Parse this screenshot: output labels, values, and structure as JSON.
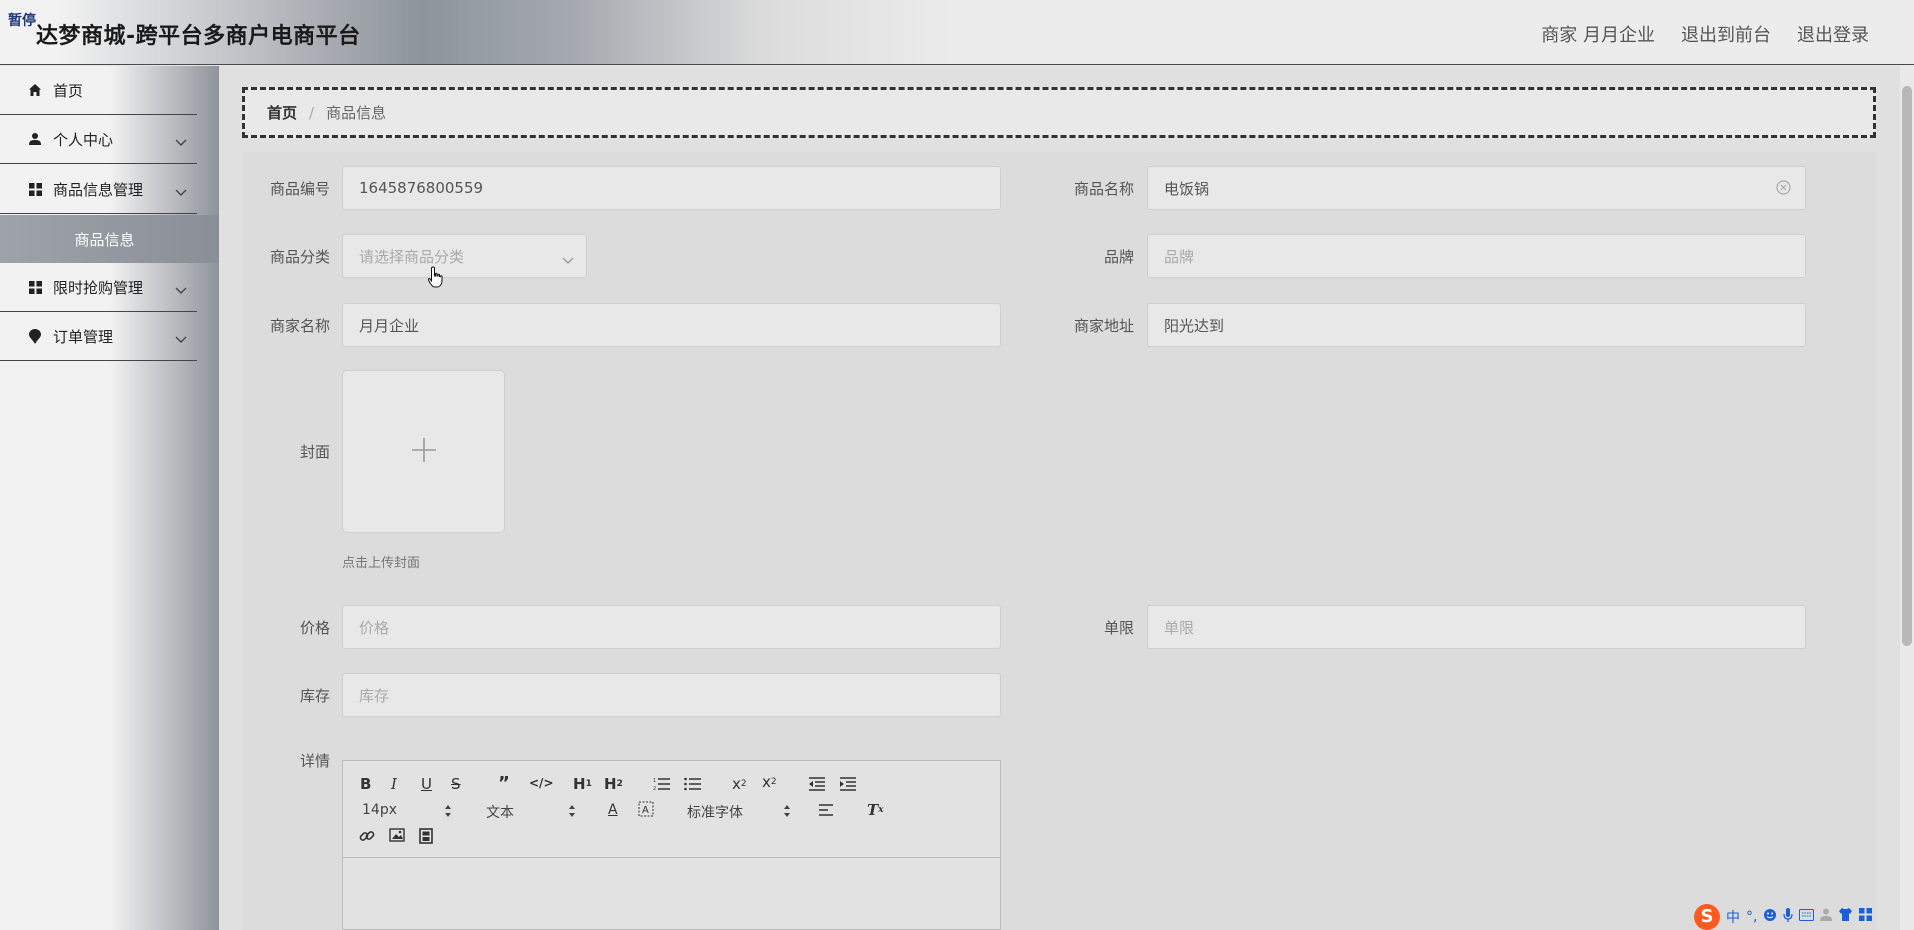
{
  "header": {
    "logo_tag": "暂停",
    "title": "达梦商城-跨平台多商户电商平台",
    "nav": [
      "商家 月月企业",
      "退出到前台",
      "退出登录"
    ]
  },
  "sidebar": {
    "items": [
      {
        "label": "首页",
        "icon": "home-icon"
      },
      {
        "label": "个人中心",
        "icon": "user-icon"
      },
      {
        "label": "商品信息管理",
        "icon": "grid-icon"
      },
      {
        "label": "限时抢购管理",
        "icon": "grid-icon"
      },
      {
        "label": "订单管理",
        "icon": "pin-icon"
      }
    ],
    "active_sub": "商品信息"
  },
  "breadcrumb": {
    "home": "首页",
    "current": "商品信息"
  },
  "form": {
    "code_label": "商品编号",
    "code_value": "1645876800559",
    "name_label": "商品名称",
    "name_value": "电饭锅",
    "category_label": "商品分类",
    "category_placeholder": "请选择商品分类",
    "brand_label": "品牌",
    "brand_placeholder": "品牌",
    "merchant_label": "商家名称",
    "merchant_value": "月月企业",
    "address_label": "商家地址",
    "address_value": "阳光达到",
    "cover_label": "封面",
    "cover_tip": "点击上传封面",
    "price_label": "价格",
    "price_placeholder": "价格",
    "limit_label": "单限",
    "limit_placeholder": "单限",
    "stock_label": "库存",
    "stock_placeholder": "库存",
    "detail_label": "详情"
  },
  "editor": {
    "font_size": "14px",
    "text_type": "文本",
    "font_family": "标准字体"
  },
  "ime": {
    "mode": "中",
    "punct": "°,"
  }
}
